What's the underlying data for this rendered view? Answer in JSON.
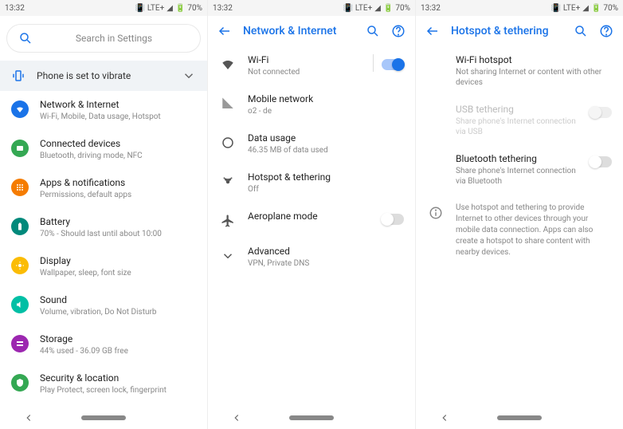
{
  "statusBar": {
    "time": "13:32",
    "network": "LTE+",
    "battery": "70%"
  },
  "panel1": {
    "searchPlaceholder": "Search in Settings",
    "vibrateText": "Phone is set to vibrate",
    "items": [
      {
        "title": "Network & Internet",
        "sub": "Wi-Fi, Mobile, Data usage, Hotspot"
      },
      {
        "title": "Connected devices",
        "sub": "Bluetooth, driving mode, NFC"
      },
      {
        "title": "Apps & notifications",
        "sub": "Permissions, default apps"
      },
      {
        "title": "Battery",
        "sub": "70% - Should last until about 10:00"
      },
      {
        "title": "Display",
        "sub": "Wallpaper, sleep, font size"
      },
      {
        "title": "Sound",
        "sub": "Volume, vibration, Do Not Disturb"
      },
      {
        "title": "Storage",
        "sub": "44% used - 36.09 GB free"
      },
      {
        "title": "Security & location",
        "sub": "Play Protect, screen lock, fingerprint"
      }
    ]
  },
  "panel2": {
    "title": "Network & Internet",
    "items": [
      {
        "title": "Wi-Fi",
        "sub": "Not connected"
      },
      {
        "title": "Mobile network",
        "sub": "o2 - de"
      },
      {
        "title": "Data usage",
        "sub": "46.35 MB of data used"
      },
      {
        "title": "Hotspot & tethering",
        "sub": "Off"
      },
      {
        "title": "Aeroplane mode",
        "sub": ""
      },
      {
        "title": "Advanced",
        "sub": "VPN, Private DNS"
      }
    ]
  },
  "panel3": {
    "title": "Hotspot & tethering",
    "items": [
      {
        "title": "Wi-Fi hotspot",
        "sub": "Not sharing Internet or content with other devices"
      },
      {
        "title": "USB tethering",
        "sub": "Share phone's Internet connection via USB"
      },
      {
        "title": "Bluetooth tethering",
        "sub": "Share phone's Internet connection via Bluetooth"
      }
    ],
    "info": "Use hotspot and tethering to provide Internet to other devices through your mobile data connection. Apps can also create a hotspot to share content with nearby devices."
  }
}
